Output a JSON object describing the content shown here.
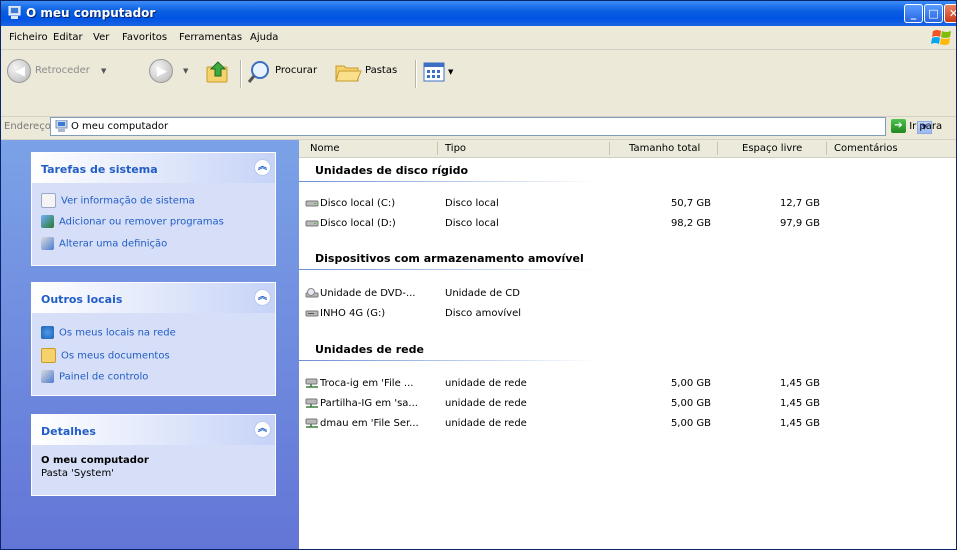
{
  "window": {
    "title": "O meu computador"
  },
  "menu": [
    "Ficheiro",
    "Editar",
    "Ver",
    "Favoritos",
    "Ferramentas",
    "Ajuda"
  ],
  "toolbar": {
    "back_label": "Retroceder",
    "search_label": "Procurar",
    "folders_label": "Pastas"
  },
  "address": {
    "label": "Endereço",
    "value": "O meu computador",
    "go_label": "Ir para"
  },
  "panels": {
    "system_tasks": {
      "title": "Tarefas de sistema",
      "items": [
        "Ver informação de sistema",
        "Adicionar ou remover programas",
        "Alterar uma definição"
      ]
    },
    "other_places": {
      "title": "Outros locais",
      "items": [
        "Os meus locais na rede",
        "Os meus documentos",
        "Painel de controlo"
      ]
    },
    "details": {
      "title": "Detalhes",
      "name": "O meu computador",
      "subtitle": "Pasta 'System'"
    }
  },
  "columns": [
    "Nome",
    "Tipo",
    "Tamanho total",
    "Espaço livre",
    "Comentários"
  ],
  "groups": [
    {
      "title": "Unidades de disco rígido",
      "items": [
        {
          "name": "Disco local (C:)",
          "type": "Disco local",
          "total": "50,7 GB",
          "free": "12,7 GB"
        },
        {
          "name": "Disco local (D:)",
          "type": "Disco local",
          "total": "98,2 GB",
          "free": "97,9 GB"
        }
      ]
    },
    {
      "title": "Dispositivos com armazenamento amovível",
      "items": [
        {
          "name": "Unidade de DVD-...",
          "type": "Unidade de CD",
          "total": "",
          "free": ""
        },
        {
          "name": "INHO 4G (G:)",
          "type": "Disco amovível",
          "total": "",
          "free": ""
        }
      ]
    },
    {
      "title": "Unidades de rede",
      "items": [
        {
          "name": "Troca-ig em 'File ...",
          "type": "unidade de rede",
          "total": "5,00 GB",
          "free": "1,45 GB"
        },
        {
          "name": "Partilha-IG em 'sa...",
          "type": "unidade de rede",
          "total": "5,00 GB",
          "free": "1,45 GB"
        },
        {
          "name": "dmau em 'File Ser...",
          "type": "unidade de rede",
          "total": "5,00 GB",
          "free": "1,45 GB"
        }
      ]
    }
  ],
  "colors": {
    "titlebar": "#0054e3",
    "task_link": "#215dc6",
    "left_pane": "#7ba2e7"
  },
  "icons": {
    "title": "computer-icon",
    "search": "magnifier-icon",
    "folders": "folder-icon",
    "views": "views-icon",
    "go": "green-arrow-icon",
    "hard_disk": "hard-disk-icon",
    "dvd": "dvd-drive-icon",
    "removable": "removable-disk-icon",
    "network_drive": "network-drive-icon"
  }
}
